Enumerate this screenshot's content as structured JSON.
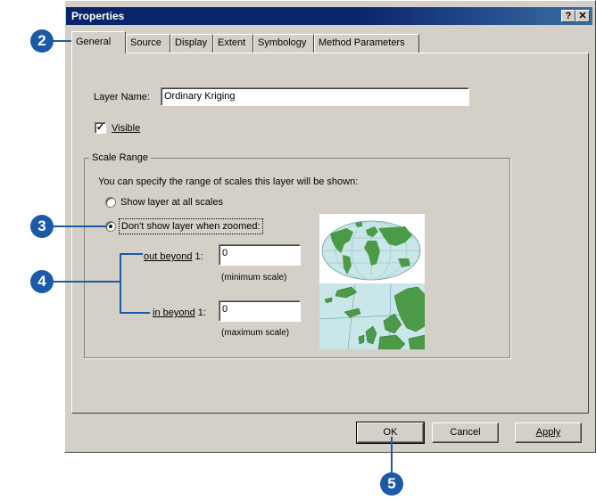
{
  "window": {
    "title": "Properties",
    "help_btn": "?",
    "close_btn": "✕"
  },
  "tabs": [
    {
      "label": "General",
      "active": true
    },
    {
      "label": "Source"
    },
    {
      "label": "Display"
    },
    {
      "label": "Extent"
    },
    {
      "label": "Symbology"
    },
    {
      "label": "Method Parameters"
    }
  ],
  "general": {
    "layer_name_label": "Layer Name:",
    "layer_name_value": "Ordinary Kriging",
    "visible_label": "Visible",
    "visible_checked": true,
    "scale_range": {
      "legend": "Scale Range",
      "description": "You can specify the range of scales this layer will be shown:",
      "option_all": "Show layer at all scales",
      "option_zoomed": "Don't show layer when zoomed:",
      "out_beyond_label": "out beyond",
      "in_beyond_label": "in beyond",
      "ratio": "1:",
      "out_value": "0",
      "in_value": "0",
      "min_hint": "(minimum scale)",
      "max_hint": "(maximum scale)"
    }
  },
  "buttons": {
    "ok": "OK",
    "cancel": "Cancel",
    "apply": "Apply"
  },
  "callouts": [
    "2",
    "3",
    "4",
    "5"
  ],
  "colors": {
    "callout": "#1b5aa8",
    "titlebar": "#0a246a",
    "dialog_bg": "#d4d0c8"
  }
}
